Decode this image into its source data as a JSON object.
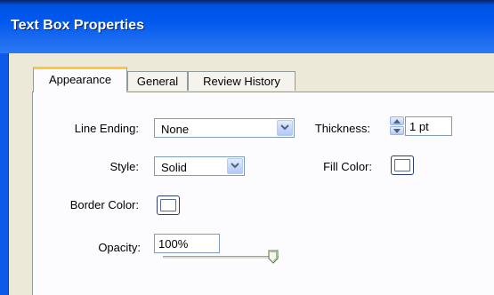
{
  "window": {
    "title": "Text Box Properties"
  },
  "tabs": [
    {
      "label": "Appearance",
      "active": true
    },
    {
      "label": "General",
      "active": false
    },
    {
      "label": "Review History",
      "active": false
    }
  ],
  "appearance": {
    "line_ending": {
      "label": "Line Ending:",
      "value": "None"
    },
    "thickness": {
      "label": "Thickness:",
      "value": "1 pt"
    },
    "style": {
      "label": "Style:",
      "value": "Solid"
    },
    "fill_color": {
      "label": "Fill Color:",
      "color": "#ffffff"
    },
    "border_color": {
      "label": "Border Color:",
      "color": "#ffffff"
    },
    "opacity": {
      "label": "Opacity:",
      "value": "100%",
      "slider_level": 1.0
    }
  },
  "colors": {
    "title_bar": "#0058ee",
    "dialog_bg": "#ece9d8",
    "active_tab_accent": "#ffc83c"
  }
}
